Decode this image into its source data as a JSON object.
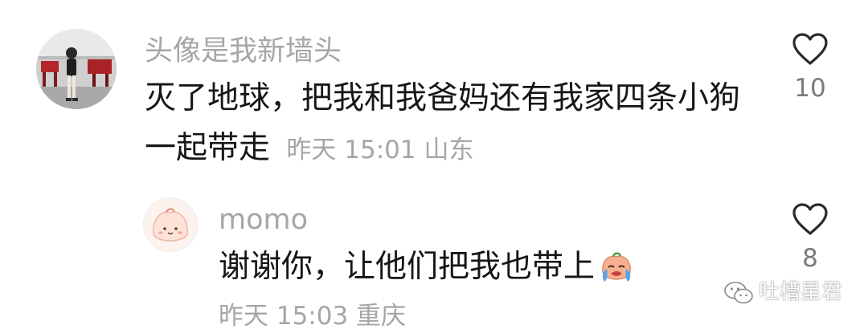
{
  "comments": [
    {
      "username": "头像是我新墙头",
      "text_line1": "灭了地球，把我和我爸妈还有我家四条小狗",
      "text_line2": "一起带走",
      "meta": "昨天 15:01 山东",
      "likes": "10",
      "avatar_icon": "gym-photo-avatar",
      "like_icon": "heart-outline-icon"
    },
    {
      "username": "momo",
      "text": "谢谢你，让他们把我也带上",
      "emoji_icon": "crying-peach-emoji",
      "meta": "昨天 15:03 重庆",
      "likes": "8",
      "avatar_icon": "cartoon-peach-avatar",
      "like_icon": "heart-outline-icon"
    }
  ],
  "watermark": {
    "label": "吐槽星君",
    "icon": "wechat-icon"
  }
}
